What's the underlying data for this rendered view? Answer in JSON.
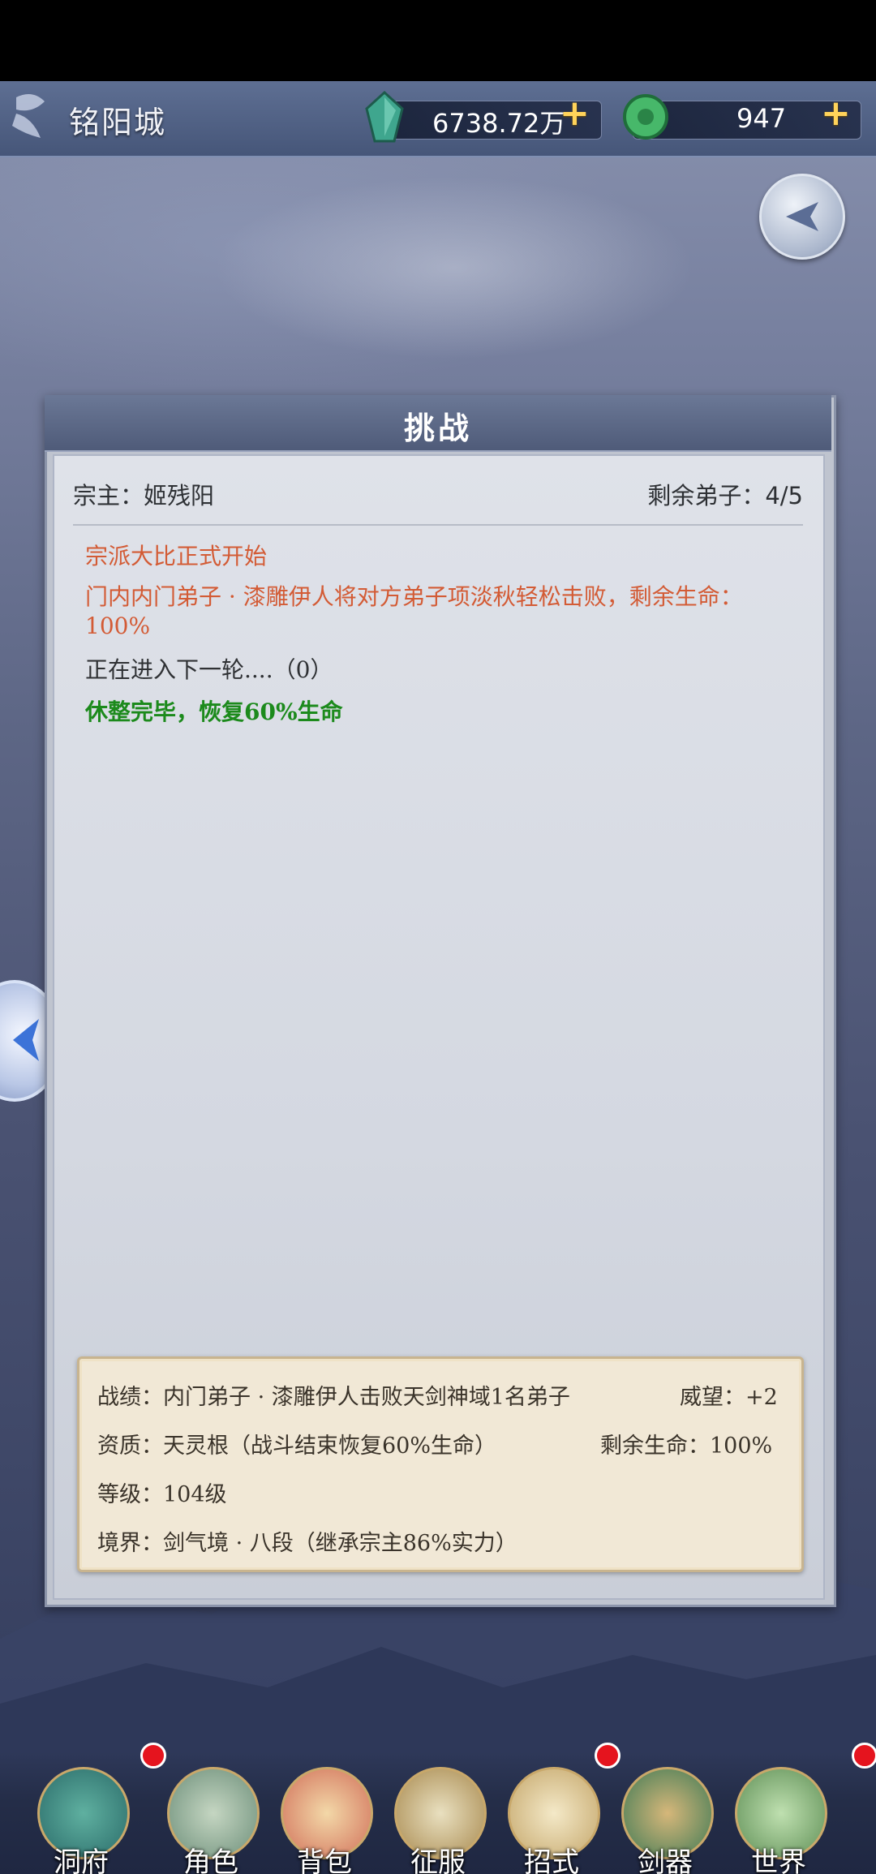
{
  "header": {
    "city": "铭阳城",
    "spirit_stones": "6738.72万",
    "jade": "947"
  },
  "panel": {
    "title": "挑战",
    "leader_label": "宗主：姬残阳",
    "remaining_label": "剩余弟子：4/5",
    "log": [
      {
        "text": "宗派大比正式开始",
        "color": "#d35b35"
      },
      {
        "text": "门内内门弟子 · 漆雕伊人将对方弟子项淡秋轻松击败，剩余生命：100%",
        "color": "#d35b35"
      },
      {
        "text": "正在进入下一轮....（0）",
        "color": "#2f3134"
      },
      {
        "text": "休整完毕，恢复60%生命",
        "color": "#1c8a1c"
      }
    ],
    "stats": {
      "record": "战绩：内门弟子 · 漆雕伊人击败天剑神域1名弟子",
      "prestige": "威望：+2",
      "aptitude": "资质：天灵根（战斗结束恢复60%生命）",
      "remaining_hp": "剩余生命：100%",
      "level": "等级：104级",
      "realm": "境界：剑气境 · 八段（继承宗主86%实力）"
    }
  },
  "nav": [
    {
      "label": "洞府",
      "icon": "cave-dwelling-icon",
      "badge": true
    },
    {
      "label": "角色",
      "icon": "character-icon",
      "badge": false
    },
    {
      "label": "背包",
      "icon": "bag-icon",
      "badge": false
    },
    {
      "label": "征服",
      "icon": "crossed-swords-icon",
      "badge": false
    },
    {
      "label": "招式",
      "icon": "scroll-icon",
      "badge": true
    },
    {
      "label": "剑器",
      "icon": "sword-artifact-icon",
      "badge": false
    },
    {
      "label": "世界",
      "icon": "world-map-icon",
      "badge": true
    }
  ]
}
